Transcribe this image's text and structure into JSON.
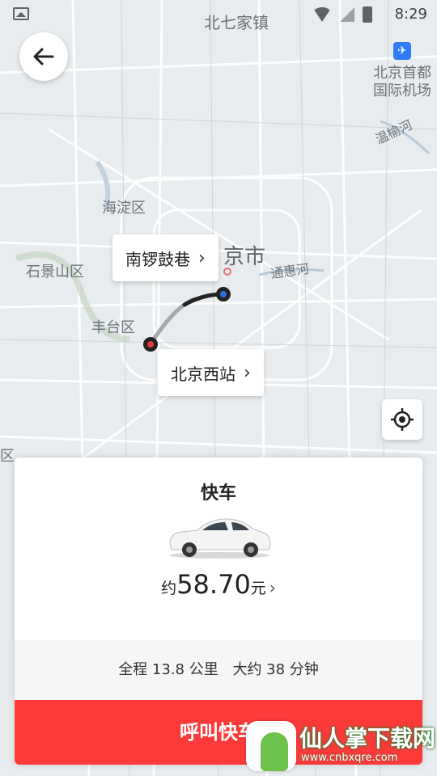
{
  "status_bar": {
    "time": "8:29"
  },
  "map": {
    "labels": {
      "beiqijia": "北七家镇",
      "airport": "北京首都\n国际机场",
      "wenyu": "温榆河",
      "haidian": "海淀区",
      "beijing": "京市",
      "shijingshan": "石景山区",
      "tonghui": "通惠河",
      "fengtai": "丰台区",
      "edge_qu": "区"
    }
  },
  "route": {
    "destination_label": "南锣鼓巷",
    "origin_label": "北京西站"
  },
  "sheet": {
    "car_type": "快车",
    "price_prefix": "约",
    "price_value": "58.70",
    "price_suffix": "元",
    "distance": "全程 13.8 公里",
    "duration": "大约 38 分钟",
    "call_button": "呼叫快车"
  },
  "watermark": {
    "title": "仙人掌下载网",
    "url": "www.cnbxqre.com"
  },
  "colors": {
    "call_button": "#fc3a3a",
    "origin_dot": "#e53935",
    "destination_dot": "#2f6fe0"
  }
}
